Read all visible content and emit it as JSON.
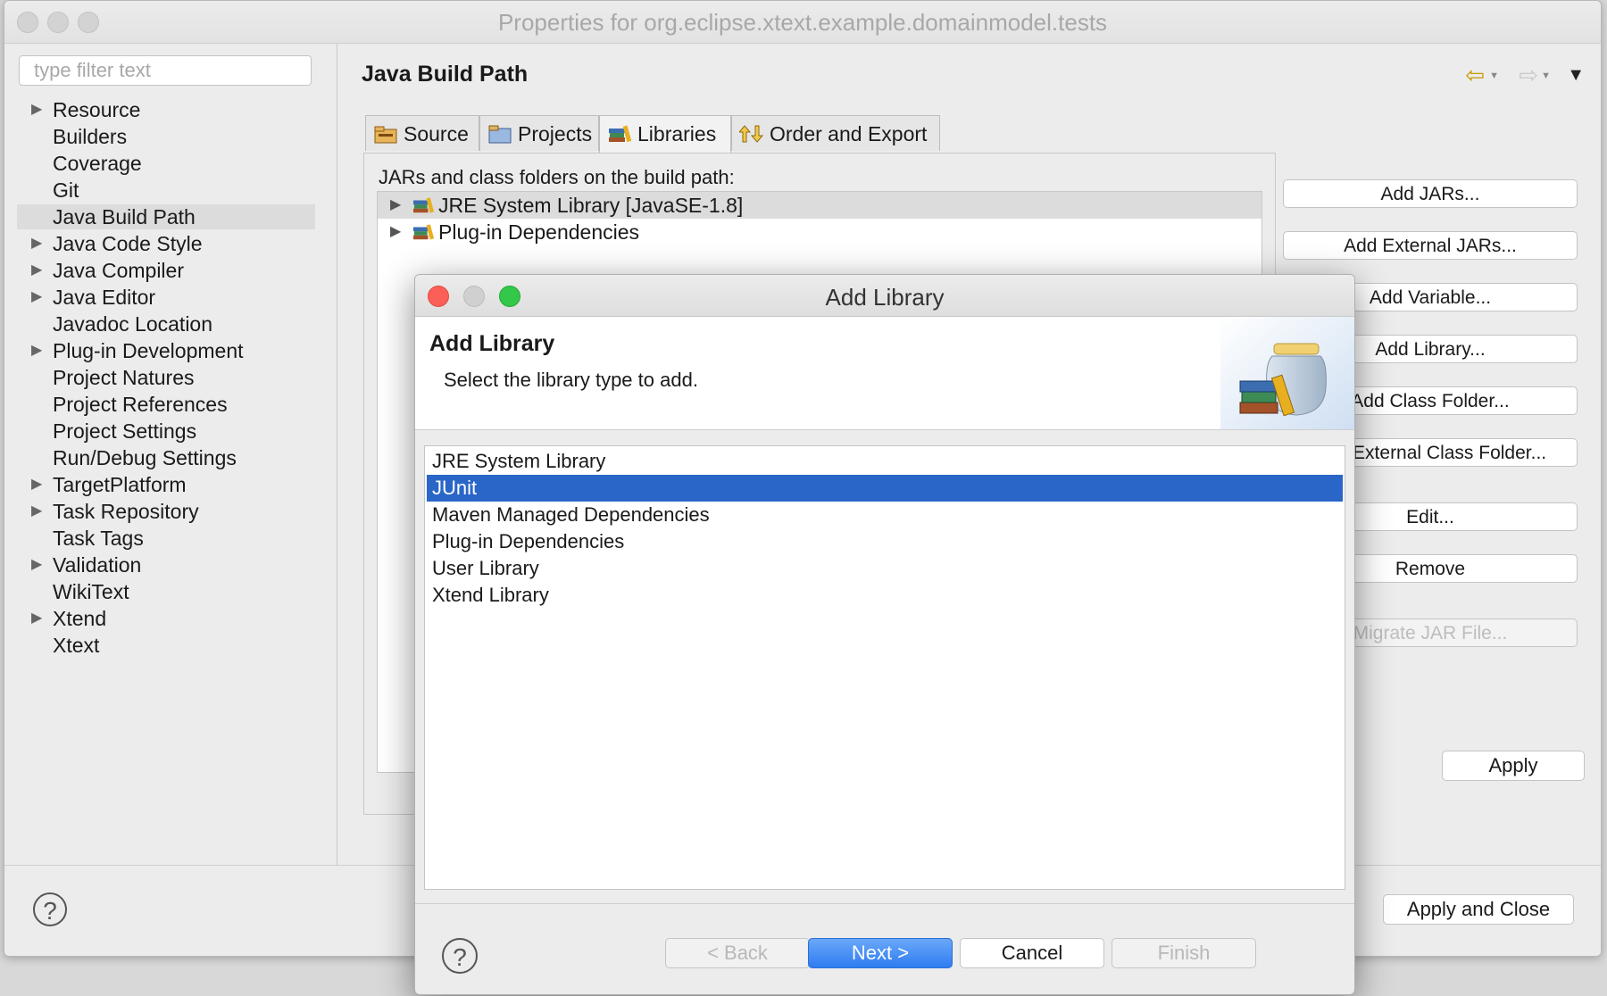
{
  "window": {
    "title": "Properties for org.eclipse.xtext.example.domainmodel.tests"
  },
  "filter": {
    "placeholder": "type filter text"
  },
  "tree": [
    {
      "label": "Resource",
      "expandable": true
    },
    {
      "label": "Builders",
      "expandable": false
    },
    {
      "label": "Coverage",
      "expandable": false
    },
    {
      "label": "Git",
      "expandable": false
    },
    {
      "label": "Java Build Path",
      "expandable": false,
      "selected": true
    },
    {
      "label": "Java Code Style",
      "expandable": true
    },
    {
      "label": "Java Compiler",
      "expandable": true
    },
    {
      "label": "Java Editor",
      "expandable": true
    },
    {
      "label": "Javadoc Location",
      "expandable": false
    },
    {
      "label": "Plug-in Development",
      "expandable": true
    },
    {
      "label": "Project Natures",
      "expandable": false
    },
    {
      "label": "Project References",
      "expandable": false
    },
    {
      "label": "Project Settings",
      "expandable": false
    },
    {
      "label": "Run/Debug Settings",
      "expandable": false
    },
    {
      "label": "TargetPlatform",
      "expandable": true
    },
    {
      "label": "Task Repository",
      "expandable": true
    },
    {
      "label": "Task Tags",
      "expandable": false
    },
    {
      "label": "Validation",
      "expandable": true
    },
    {
      "label": "WikiText",
      "expandable": false
    },
    {
      "label": "Xtend",
      "expandable": true
    },
    {
      "label": "Xtext",
      "expandable": false
    }
  ],
  "page": {
    "title": "Java Build Path",
    "nav": {
      "back_icon": "back-arrow-icon",
      "forward_icon": "forward-arrow-icon",
      "menu_icon": "view-menu-icon"
    },
    "tabs": [
      {
        "label": "Source",
        "icon": "source-folder-icon"
      },
      {
        "label": "Projects",
        "icon": "projects-folder-icon"
      },
      {
        "label": "Libraries",
        "icon": "library-icon",
        "active": true
      },
      {
        "label": "Order and Export",
        "icon": "order-export-icon"
      }
    ],
    "libraries_caption": "JARs and class folders on the build path:",
    "libraries": [
      {
        "label": "JRE System Library [JavaSE-1.8]",
        "selected": true
      },
      {
        "label": "Plug-in Dependencies"
      }
    ],
    "buttons": {
      "add_jars": "Add JARs...",
      "add_external_jars": "Add External JARs...",
      "add_variable": "Add Variable...",
      "add_library": "Add Library...",
      "add_class_folder": "Add Class Folder...",
      "add_external_class_folder": "Add External Class Folder...",
      "edit": "Edit...",
      "remove": "Remove",
      "migrate_jar": "Migrate JAR File...",
      "apply": "Apply"
    }
  },
  "footer": {
    "apply_and_close": "Apply and Close",
    "help_icon": "help-icon"
  },
  "dialog": {
    "title": "Add Library",
    "heading": "Add Library",
    "description": "Select the library type to add.",
    "options": [
      {
        "label": "JRE System Library"
      },
      {
        "label": "JUnit",
        "selected": true
      },
      {
        "label": "Maven Managed Dependencies"
      },
      {
        "label": "Plug-in Dependencies"
      },
      {
        "label": "User Library"
      },
      {
        "label": "Xtend Library"
      }
    ],
    "buttons": {
      "back": "< Back",
      "next": "Next >",
      "cancel": "Cancel",
      "finish": "Finish"
    },
    "colors": {
      "selection": "#2a66c8",
      "close": "#fc5f57",
      "minimize": "#d0d0d0",
      "zoom": "#34c84a"
    }
  }
}
